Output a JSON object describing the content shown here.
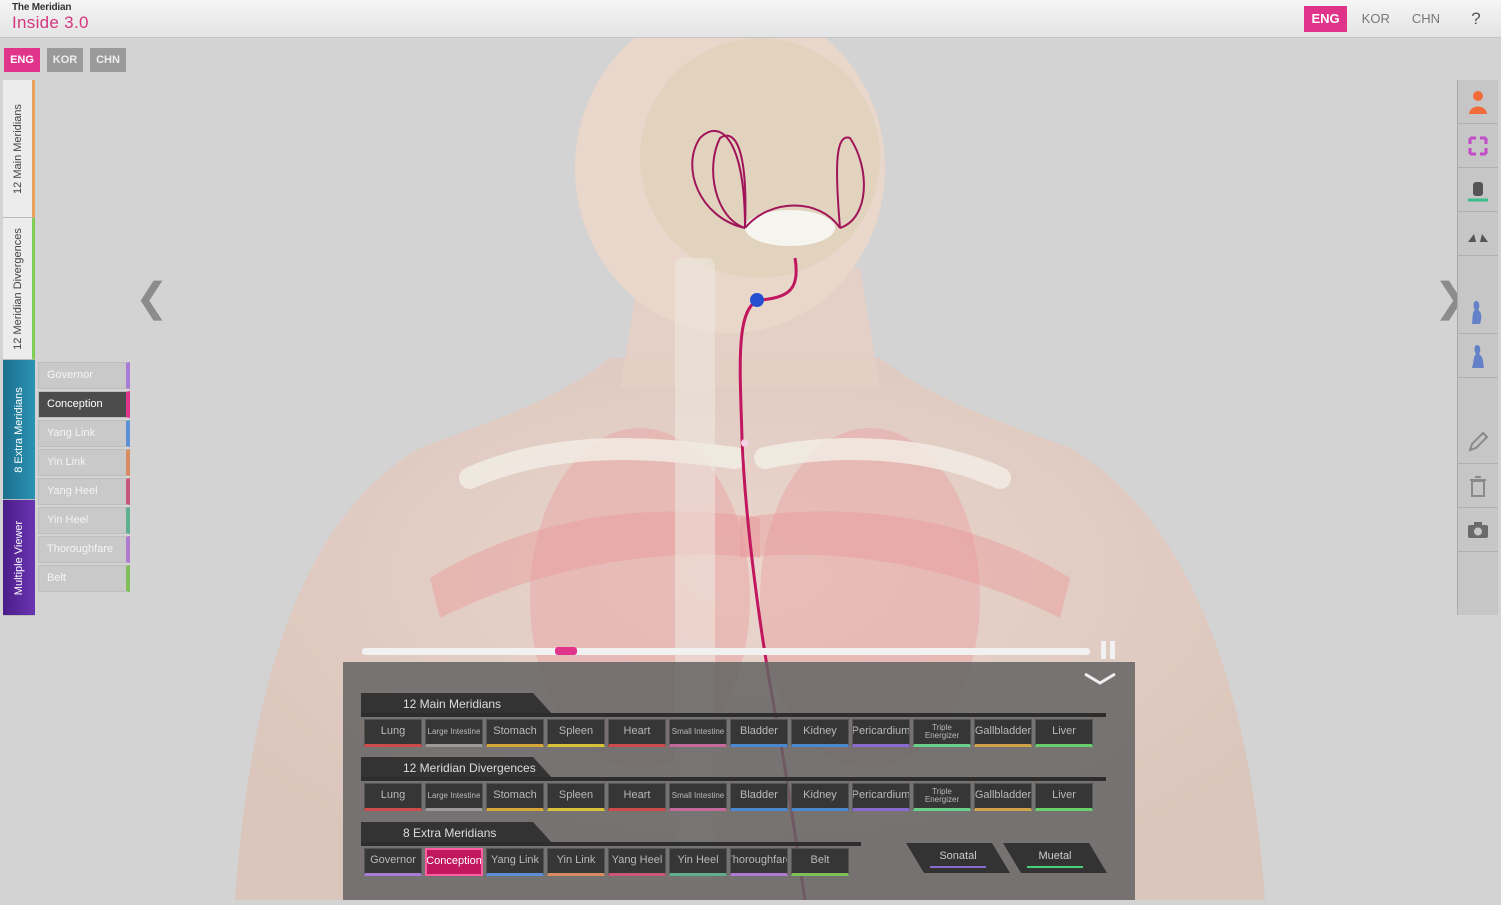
{
  "app": {
    "title_line1": "The Meridian",
    "title_line2": "Inside 3.0"
  },
  "header": {
    "languages": [
      "ENG",
      "KOR",
      "CHN"
    ],
    "active_language": "ENG",
    "help_label": "?"
  },
  "left_languages": [
    "ENG",
    "KOR",
    "CHN"
  ],
  "side_tabs": [
    {
      "label": "12 Main Meridians",
      "accent": "#e7a25c"
    },
    {
      "label": "12 Meridian Divergences",
      "accent": "#7fcf57"
    },
    {
      "label": "8 Extra Meridians",
      "accent": "#2b93b3"
    },
    {
      "label": "Multiple Viewer",
      "accent": "#6a34b2"
    }
  ],
  "extra_meridian_list": [
    {
      "label": "Governor",
      "color": "#a77bd6"
    },
    {
      "label": "Conception",
      "color": "#e0338a"
    },
    {
      "label": "Yang Link",
      "color": "#5c8fd6"
    },
    {
      "label": "Yin Link",
      "color": "#d98c5f"
    },
    {
      "label": "Yang Heel",
      "color": "#c9567a"
    },
    {
      "label": "Yin Heel",
      "color": "#5fae8d"
    },
    {
      "label": "Thoroughfare",
      "color": "#b07ad0"
    },
    {
      "label": "Belt",
      "color": "#7fbf5a"
    }
  ],
  "active_extra": "Conception",
  "nav": {
    "prev": "❮",
    "next": "❯"
  },
  "toolbar": [
    {
      "icon": "person-orange-icon",
      "color": "#f26b3a"
    },
    {
      "icon": "rotate-arrows-icon",
      "color": "#c44bc8"
    },
    {
      "icon": "pan-hand-icon",
      "color": "#3bbf8a"
    },
    {
      "icon": "feet-icon",
      "color": "#555555"
    },
    {
      "icon": "body-front-icon",
      "color": "#4a6fc9"
    },
    {
      "icon": "body-side-icon",
      "color": "#4a6fc9"
    },
    {
      "icon": "pencil-icon",
      "color": "#8a8a8a"
    },
    {
      "icon": "trash-icon",
      "color": "#8a8a8a"
    },
    {
      "icon": "camera-icon",
      "color": "#6a6a6a"
    }
  ],
  "timeline": {
    "progress": 0.28
  },
  "bottom_panel": {
    "main_header": "12 Main Meridians",
    "main_buttons": [
      {
        "label": "Lung",
        "color": "#cf4a4a"
      },
      {
        "label": "Large Intestine",
        "color": "#9a9a9a"
      },
      {
        "label": "Stomach",
        "color": "#d7a63a"
      },
      {
        "label": "Spleen",
        "color": "#d7c23a"
      },
      {
        "label": "Heart",
        "color": "#cf4a4a"
      },
      {
        "label": "Small Intestine",
        "color": "#c46a9a"
      },
      {
        "label": "Bladder",
        "color": "#4a88cf"
      },
      {
        "label": "Kidney",
        "color": "#4a88cf"
      },
      {
        "label": "Pericardium",
        "color": "#8a6acf"
      },
      {
        "label": "Triple Energizer",
        "color": "#6acf8a"
      },
      {
        "label": "Gallbladder",
        "color": "#cfa24a"
      },
      {
        "label": "Liver",
        "color": "#6acf6a"
      }
    ],
    "divergence_header": "12 Meridian Divergences",
    "divergence_buttons": [
      {
        "label": "Lung",
        "color": "#cf4a4a"
      },
      {
        "label": "Large Intestine",
        "color": "#9a9a9a"
      },
      {
        "label": "Stomach",
        "color": "#d7a63a"
      },
      {
        "label": "Spleen",
        "color": "#d7c23a"
      },
      {
        "label": "Heart",
        "color": "#cf4a4a"
      },
      {
        "label": "Small Intestine",
        "color": "#c46a9a"
      },
      {
        "label": "Bladder",
        "color": "#4a88cf"
      },
      {
        "label": "Kidney",
        "color": "#4a88cf"
      },
      {
        "label": "Pericardium",
        "color": "#8a6acf"
      },
      {
        "label": "Triple Energizer",
        "color": "#6acf8a"
      },
      {
        "label": "Gallbladder",
        "color": "#cfa24a"
      },
      {
        "label": "Liver",
        "color": "#6acf6a"
      }
    ],
    "extra_header": "8 Extra Meridians",
    "extra_buttons": [
      {
        "label": "Governor",
        "color": "#a77bd6"
      },
      {
        "label": "Conception",
        "color": "#e0338a"
      },
      {
        "label": "Yang Link",
        "color": "#5c8fd6"
      },
      {
        "label": "Yin Link",
        "color": "#d98c5f"
      },
      {
        "label": "Yang Heel",
        "color": "#c9567a"
      },
      {
        "label": "Yin Heel",
        "color": "#5fae8d"
      },
      {
        "label": "Thoroughfare",
        "color": "#b07ad0"
      },
      {
        "label": "Belt",
        "color": "#7fbf5a"
      }
    ],
    "mode_buttons": [
      {
        "label": "Sonatal",
        "color": "#8a6acf"
      },
      {
        "label": "Muetal",
        "color": "#4acf7a"
      }
    ]
  }
}
